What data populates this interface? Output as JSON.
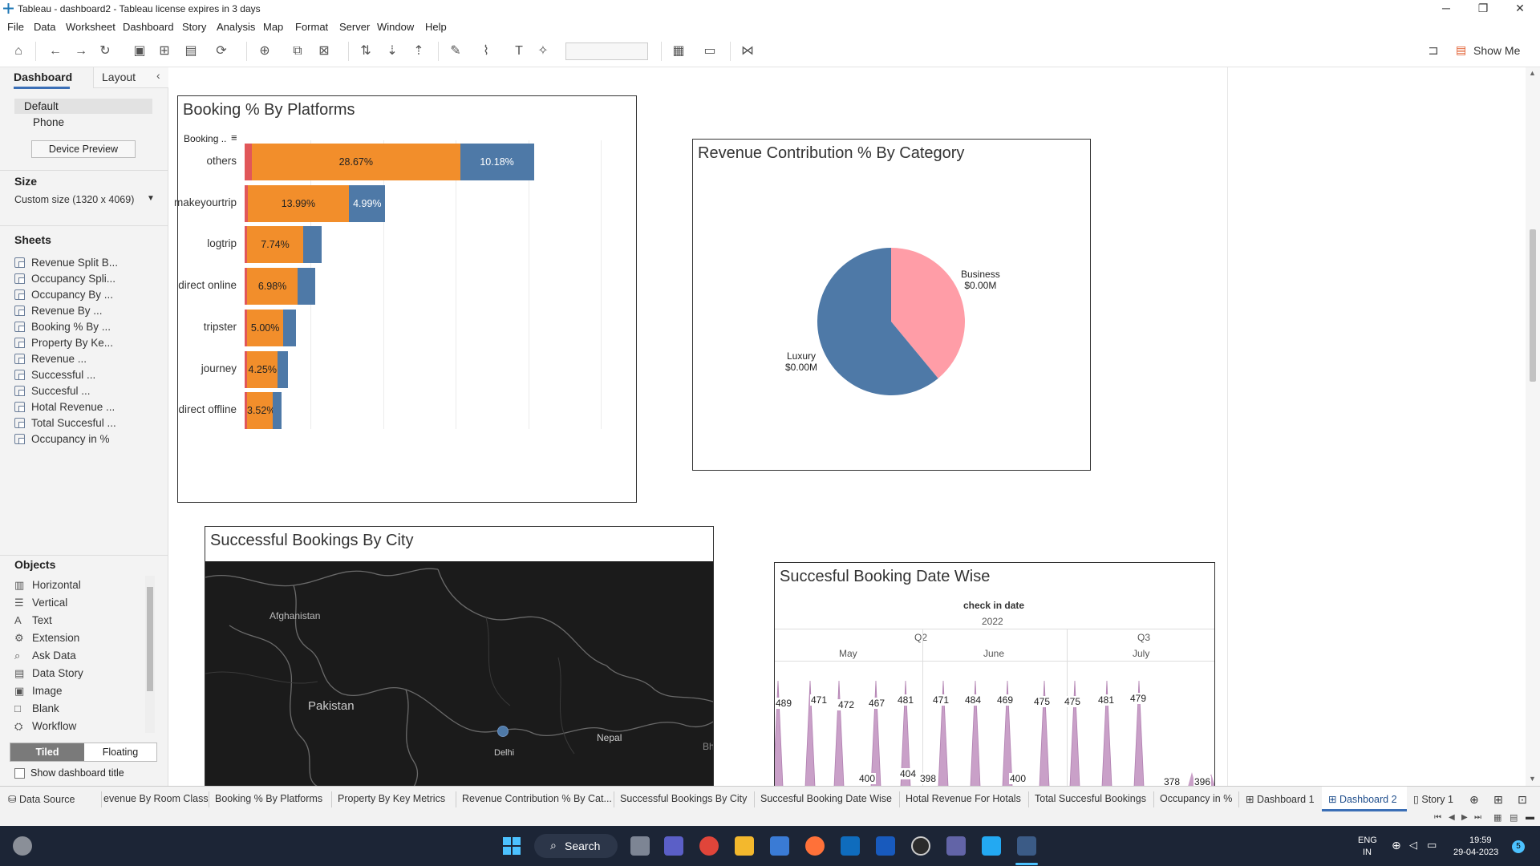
{
  "window": {
    "title": "Tableau - dashboard2 - Tableau license expires in 3 days",
    "minimize": "─",
    "maximize": "❐",
    "close": "✕"
  },
  "menu": [
    "File",
    "Data",
    "Worksheet",
    "Dashboard",
    "Story",
    "Analysis",
    "Map",
    "Format",
    "Server",
    "Window",
    "Help"
  ],
  "toolbar": {
    "show_me": "Show Me"
  },
  "left_pane": {
    "tabs": {
      "dashboard": "Dashboard",
      "layout": "Layout"
    },
    "devices": {
      "default": "Default",
      "phone": "Phone",
      "preview_button": "Device Preview"
    },
    "size": {
      "heading": "Size",
      "value": "Custom size (1320 x 4069)"
    },
    "sheets_heading": "Sheets",
    "sheets": [
      "Revenue Split B...",
      "Occupancy Spli...",
      "Occupancy By ...",
      "Revenue By ...",
      "Booking % By ...",
      "Property By Ke...",
      "Revenue ...",
      "Successful ...",
      "Succesful ...",
      "Hotal Revenue ...",
      "Total Succesful ...",
      "Occupancy in %"
    ],
    "objects_heading": "Objects",
    "objects": [
      {
        "label": "Horizontal",
        "icon": "horizontal-icon",
        "glyph": "▥"
      },
      {
        "label": "Vertical",
        "icon": "vertical-icon",
        "glyph": "☰"
      },
      {
        "label": "Text",
        "icon": "text-icon",
        "glyph": "A"
      },
      {
        "label": "Extension",
        "icon": "extension-icon",
        "glyph": "⚙"
      },
      {
        "label": "Ask Data",
        "icon": "ask-data-icon",
        "glyph": "⌕"
      },
      {
        "label": "Data Story",
        "icon": "data-story-icon",
        "glyph": "▤"
      },
      {
        "label": "Image",
        "icon": "image-icon",
        "glyph": "▣"
      },
      {
        "label": "Blank",
        "icon": "blank-icon",
        "glyph": "□"
      },
      {
        "label": "Workflow",
        "icon": "workflow-icon",
        "glyph": "⛭"
      }
    ],
    "tiled": "Tiled",
    "floating": "Floating",
    "show_title": "Show dashboard title"
  },
  "booking_panel": {
    "title": "Booking % By Platforms",
    "sort_label": "Booking ..",
    "colors": {
      "red": "#e15759",
      "orange": "#f28e2b",
      "blue": "#4e79a7"
    }
  },
  "chart_data": [
    {
      "type": "bar",
      "title": "Booking % By Platforms",
      "categories": [
        "others",
        "makeyourtrip",
        "logtrip",
        "direct online",
        "tripster",
        "journey",
        "direct offline"
      ],
      "series": [
        {
          "values": [
            1.0,
            0.4,
            0.2,
            0.1,
            0.05,
            0.05,
            0.05
          ]
        },
        {
          "values": [
            28.67,
            13.99,
            7.74,
            6.98,
            5.0,
            4.25,
            3.52
          ]
        },
        {
          "values": [
            10.18,
            4.99,
            2.5,
            2.4,
            1.7,
            1.4,
            1.2
          ]
        }
      ],
      "labels": [
        "28.67%",
        "13.99%",
        "7.74%",
        "6.98%",
        "5.00%",
        "4.25%",
        "3.52%"
      ],
      "blue_labels": [
        "10.18%",
        "4.99%",
        "",
        "",
        "",
        "",
        ""
      ]
    },
    {
      "type": "pie",
      "title": "Revenue Contribution % By Category",
      "slices": [
        {
          "name": "Business",
          "value": 39,
          "label_value": "$0.00M",
          "color": "#ff9da7"
        },
        {
          "name": "Luxury",
          "value": 61,
          "label_value": "$0.00M",
          "color": "#4e79a7"
        }
      ]
    },
    {
      "type": "area",
      "title": "Succesful Booking Date Wise",
      "header": {
        "field": "check in date",
        "year": "2022",
        "quarters": [
          "Q2",
          "Q3"
        ],
        "months": [
          "May",
          "June",
          "July"
        ]
      },
      "labels": [
        "489",
        "471",
        "472",
        "467",
        "481",
        "471",
        "484",
        "469",
        "475",
        "475",
        "481",
        "479",
        "400",
        "404",
        "398",
        "400",
        "378",
        "396"
      ],
      "color": "#c9a0c8"
    }
  ],
  "map_panel": {
    "title": "Successful Bookings By City",
    "places": [
      "Afghanistan",
      "Pakistan",
      "Delhi",
      "Nepal",
      "Bh"
    ]
  },
  "tabs": [
    "Data Source",
    "evenue By Room Class",
    "Booking % By Platforms",
    "Property By Key Metrics",
    "Revenue Contribution % By Cat...",
    "Successful Bookings By City",
    "Succesful Booking Date Wise",
    "Hotal Revenue For Hotals",
    "Total Succesful Bookings",
    "Occupancy in %",
    "Dashboard 1",
    "Dashboard 2",
    "Story 1"
  ],
  "taskbar": {
    "search": "Search",
    "lang": "ENG",
    "region": "IN",
    "time": "19:59",
    "date": "29-04-2023",
    "badge": "5"
  }
}
